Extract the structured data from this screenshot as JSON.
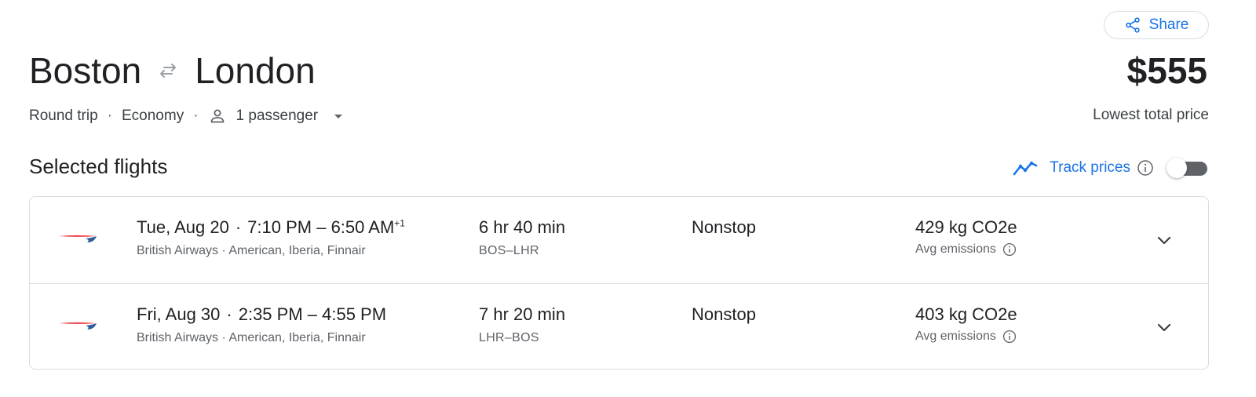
{
  "header": {
    "share_label": "Share",
    "origin": "Boston",
    "destination": "London",
    "price": "$555",
    "price_label": "Lowest total price",
    "trip_type": "Round trip",
    "cabin": "Economy",
    "passengers": "1 passenger"
  },
  "section": {
    "title": "Selected flights",
    "track_label": "Track prices"
  },
  "flights": [
    {
      "date": "Tue, Aug 20",
      "time": "7:10 PM – 6:50 AM",
      "day_offset": "+1",
      "airlines": "British Airways · American, Iberia, Finnair",
      "duration": "6 hr 40 min",
      "route": "BOS–LHR",
      "stops": "Nonstop",
      "emissions": "429 kg CO2e",
      "emissions_label": "Avg emissions"
    },
    {
      "date": "Fri, Aug 30",
      "time": "2:35 PM – 4:55 PM",
      "day_offset": "",
      "airlines": "British Airways · American, Iberia, Finnair",
      "duration": "7 hr 20 min",
      "route": "LHR–BOS",
      "stops": "Nonstop",
      "emissions": "403 kg CO2e",
      "emissions_label": "Avg emissions"
    }
  ],
  "icons": {
    "share": "share-icon",
    "swap": "swap-arrows-icon",
    "person": "person-icon",
    "caret": "caret-down-icon",
    "trend": "trend-line-icon",
    "info": "info-icon",
    "airline_logo": "british-airways-logo",
    "expand": "chevron-down-icon"
  },
  "colors": {
    "accent": "#1a73e8",
    "text_primary": "#202124",
    "text_secondary": "#5f6368",
    "border": "#dadce0",
    "ba_red": "#eb2226",
    "ba_blue": "#2e5c99"
  },
  "track_prices_enabled": false
}
